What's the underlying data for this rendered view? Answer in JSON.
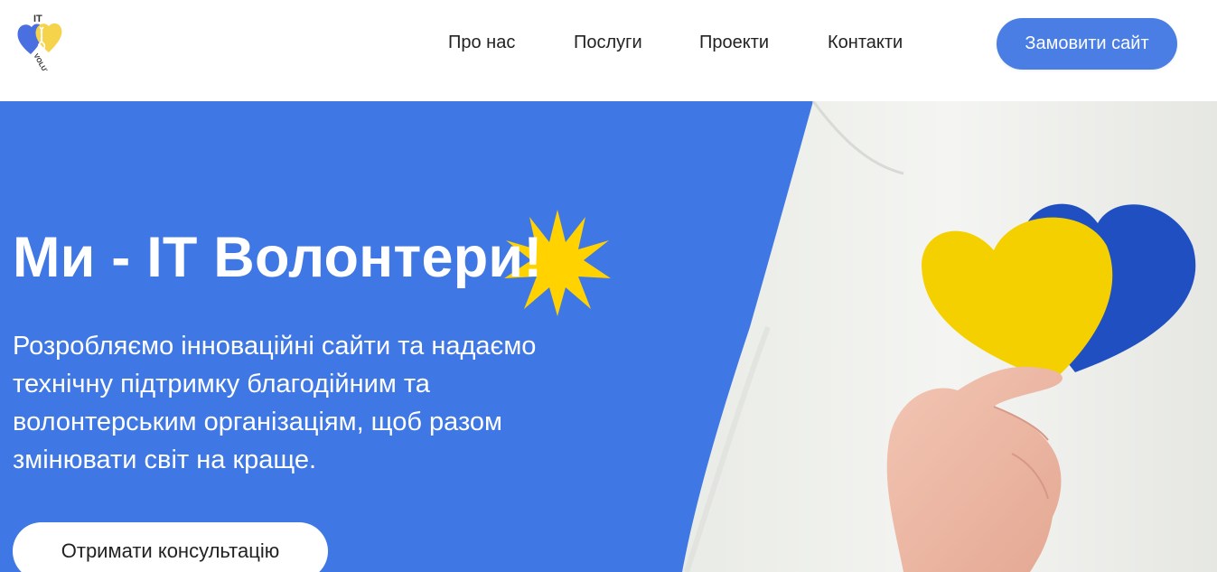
{
  "brand": {
    "logo_text_top": "IT",
    "logo_text_arc": "VOLUNTEERS",
    "colors": {
      "blue": "#4a7ee5",
      "yellow": "#f5d000",
      "hero_bg": "#3f78e4"
    }
  },
  "nav": {
    "items": [
      {
        "label": "Про нас"
      },
      {
        "label": "Послуги"
      },
      {
        "label": "Проекти"
      },
      {
        "label": "Контакти"
      }
    ],
    "cta_label": "Замовити сайт"
  },
  "hero": {
    "title": "Ми - IT Волонтери!",
    "description": "Розробляємо інноваційні сайти та надаємо технічну підтримку благодійним та волонтерським організаціям, щоб разом змінювати світ на краще.",
    "button_label": "Отримати консультацію",
    "decoration_icon": "sun-icon",
    "photo": "hand-holding-hearts-photo"
  }
}
